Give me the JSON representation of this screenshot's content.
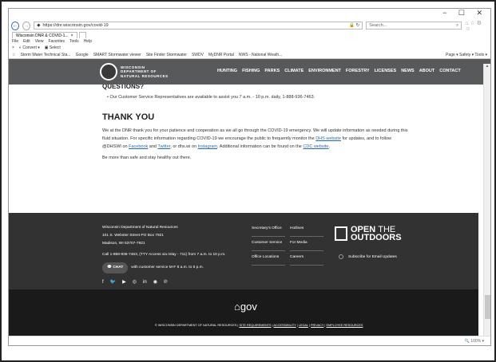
{
  "browser": {
    "window_controls": "− ☐ ✕",
    "url": "https://dnr.wisconsin.gov/covid-19",
    "url_icons": "🔒 ↻",
    "search_placeholder": "Search...",
    "search_icon": "search-icon",
    "tab_title": "Wisconsin DNR & COVID-1...",
    "menu_items": [
      "File",
      "Edit",
      "View",
      "Favorites",
      "Tools",
      "Help"
    ],
    "cmd_items": [
      "Convert",
      "Select"
    ],
    "favorites": [
      "Storm Water Technical Sta...",
      "Google",
      "SMART Stormwater viewer",
      "Site Finder Stormwater",
      "SWDV",
      "MyDNR Portal",
      "NWS - National Weath..."
    ],
    "toolbar_right": "Page ▾  Safety ▾  Tools ▾",
    "zoom": "100%"
  },
  "site": {
    "logo_line1": "WISCONSIN",
    "logo_line2": "DEPARTMENT OF",
    "logo_line3": "NATURAL RESOURCES",
    "nav": [
      "HUNTING",
      "FISHING",
      "PARKS",
      "CLIMATE",
      "ENVIRONMENT",
      "FORESTRY",
      "LICENSES",
      "NEWS",
      "ABOUT",
      "CONTACT"
    ]
  },
  "content": {
    "questions_heading": "QUESTIONS?",
    "questions_item": "Our Customer Service Representatives are available to assist you 7 a.m. - 10 p.m. daily, 1-888-936-7463.",
    "thanks_heading": "THANK YOU",
    "para_1": "We at the DNR thank you for your patience and cooperation as we all go through the COVID-19 emergency. We will update information as needed during this fluid situation. For specific information regarding COVID-19 we encourage the public to frequently monitor the",
    "link_dhs": "DHS website",
    "para_2": "for updates, and to follow @DHSWI on",
    "link_facebook": "Facebook",
    "para_3": "and",
    "link_twitter": "Twitter",
    "para_4": ", or dhs.wi on",
    "link_instagram": "Instagram",
    "para_5": ". Additional information can be found on the",
    "link_cdc": "CDC website",
    "para_6": ".",
    "closing": "Be more than safe and stay healthy out there."
  },
  "footer": {
    "org": "Wisconsin Department of Natural Resources",
    "street": "101 S. Webster Street PO Box 7921",
    "city": "Madison, WI 53707-7921",
    "call": "Call 1-888-936-7463, (TTY Access via relay - 711) from 7 a.m. to 10 p.m.",
    "chat_label": "CHAT",
    "chat_text": "with customer service M-F 8 a.m. to 5 p.m.",
    "social_icons": [
      "facebook-icon",
      "twitter-icon",
      "youtube-icon",
      "instagram-icon",
      "linkedin-icon",
      "podcast-icon",
      "pinterest-icon"
    ],
    "col1": [
      "Secretary's Office",
      "Customer Service",
      "Office Locations"
    ],
    "col2": [
      "Hotlines",
      "For Media",
      "Careers"
    ],
    "otd_line1": "OPEN",
    "otd_line1b": "THE",
    "otd_line2": "OUTDOORS",
    "subscribe": "Subscribe for Email Updates",
    "gov_logo": "gov",
    "copyright": "© WISCONSIN DEPARTMENT OF NATURAL RESOURCES |",
    "legal_links": [
      "SITE REQUIREMENTS",
      "ACCESSIBILITY",
      "LEGAL",
      "PRIVACY",
      "EMPLOYEE RESOURCES"
    ]
  }
}
